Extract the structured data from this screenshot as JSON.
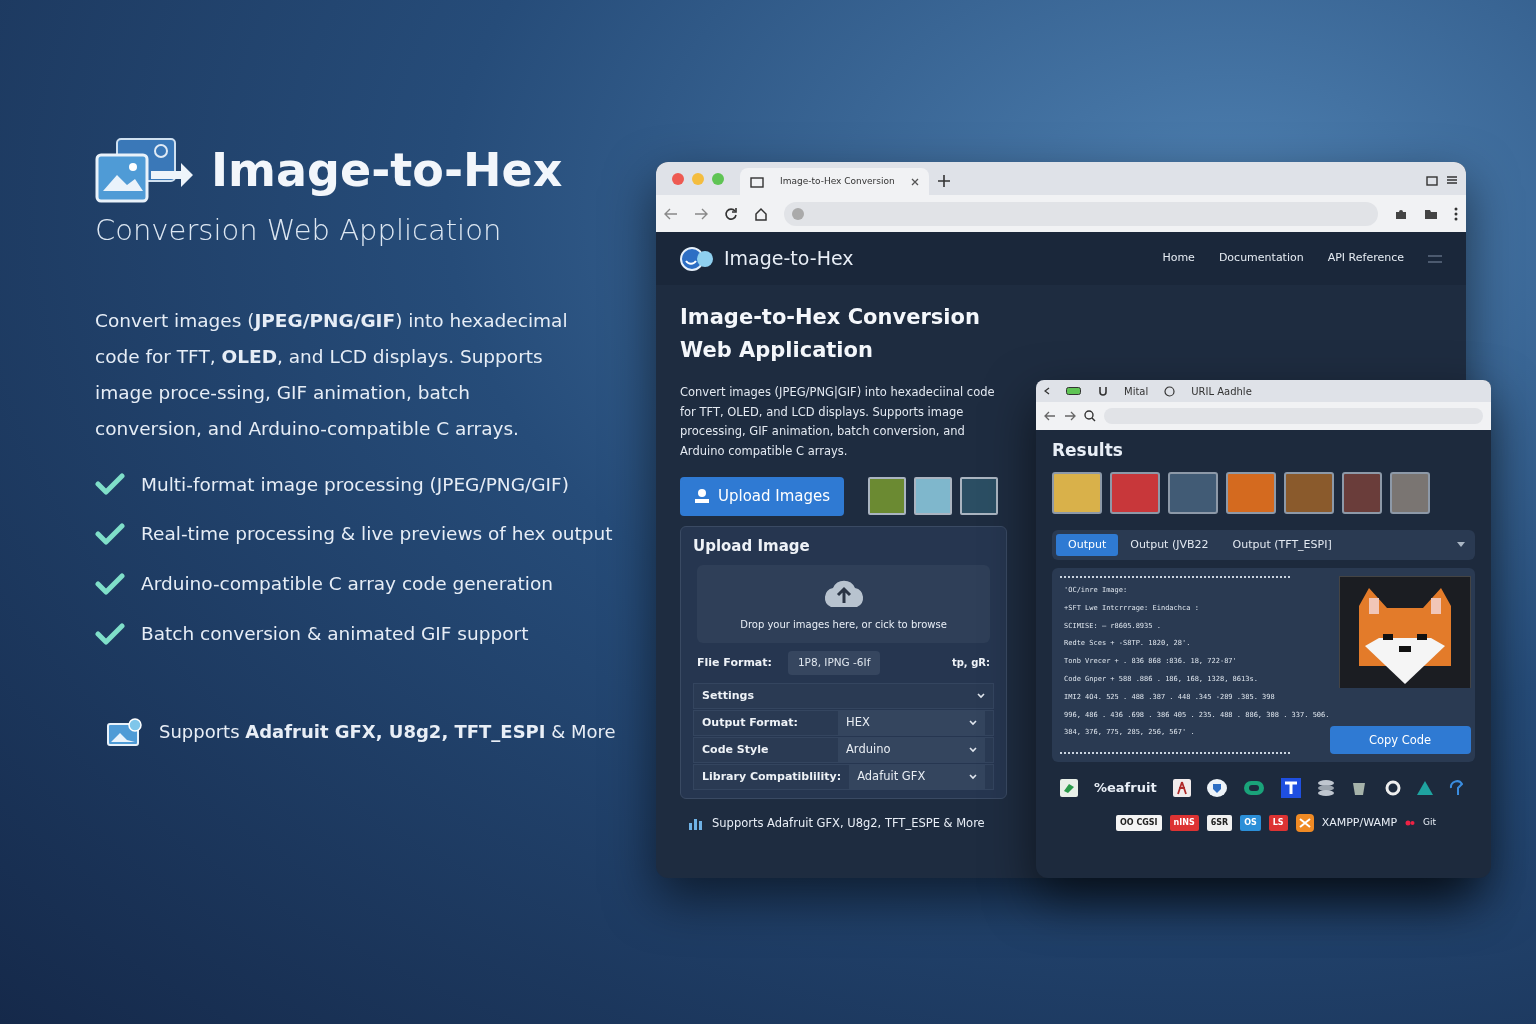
{
  "promo": {
    "title": "Image-to-Hex",
    "subtitle": "Conversion Web Application",
    "intro": "Convert images (**JPEG/PNG/GIF**) into hexadecimal code for TFT, **OLED**, and LCD displays. Supports image proce-ssing, GIF animation, batch conversion, and Arduino-compatible C arrays.",
    "features": [
      "Multi-format image processing (JPEG/PNG/GIF)",
      "Real-time processing & live previews of hex output",
      "Arduino-compatible C array code generation",
      "Batch conversion & animated GIF support"
    ],
    "supports": "Supports **Adafruit GFX, U8g2, TFT_ESPI** & More"
  },
  "browser": {
    "tab": "Image-to-Hex Conversion",
    "navbar": {
      "brand": "Image-to-Hex",
      "links": [
        "Home",
        "Documentation",
        "API Reference"
      ]
    },
    "hero": {
      "title": "Image-to-Hex Conversion Web Application",
      "description": "Convert images (JPEG/PNG|GIF) into hexadeciinal code for TFT, OLED, and LCD displays. Supports image processing, GIF animation, batch conversion, and Arduino compatible C arrays.",
      "upload_button": "Upload Images"
    },
    "upload_card": {
      "title": "Upload Image",
      "drop_text": "Drop your images here, or cick to browse",
      "format_label": "Flie Format:",
      "format_value": "1P8, IPNG -6If",
      "format_extra": "tp, gR:",
      "settings": [
        {
          "label": "Settings"
        },
        {
          "label": "Output Format:",
          "value": "HEX"
        },
        {
          "label": "Code Style",
          "value": "Arduino"
        },
        {
          "label": "Library Compatiblility:",
          "value": "Adafuit GFX"
        }
      ]
    },
    "footer": "Supports Adafruit GFX, U8g2, TFT_ESPE & More"
  },
  "results_window": {
    "tabs": [
      "Mital",
      "URIL Aadhle"
    ],
    "title": "Results",
    "output_tabs": [
      {
        "label": "Output",
        "selected": true
      },
      {
        "label": "Output (JVB22",
        "selected": false
      },
      {
        "label": "Output (TFT_ESPI]",
        "selected": false
      }
    ],
    "code_lines": [
      "'OC/inre Image:",
      "+SFT Lwe Intcrrrage: Eindachca :",
      "SCIMISE: – r8605.8935 .",
      "Redte Sces + -S8TP. 1820, 28'.",
      "Tonb Vrecer + . 836 868 :836. 18, 722-87'",
      "Code Gnper + 588 .886 . 186, 168, 1328, 8613s.",
      "IMI2 4O4. 525 . 488 .387 . 448 .345 -289 .385. 398",
      "996, 486 . 436 .698 . 386 405 . 235. 488 . 886, 308 . 337. 506.",
      "384, 376, 775, 285, 256, 567' ."
    ],
    "copy_button": "Copy Code",
    "logo_label": "%eafruit",
    "badges": [
      "OO CGSI",
      "nINS",
      "6SR",
      "OS",
      "LS"
    ],
    "extra_labels": [
      "XAMPP/WAMP",
      "Git"
    ]
  }
}
